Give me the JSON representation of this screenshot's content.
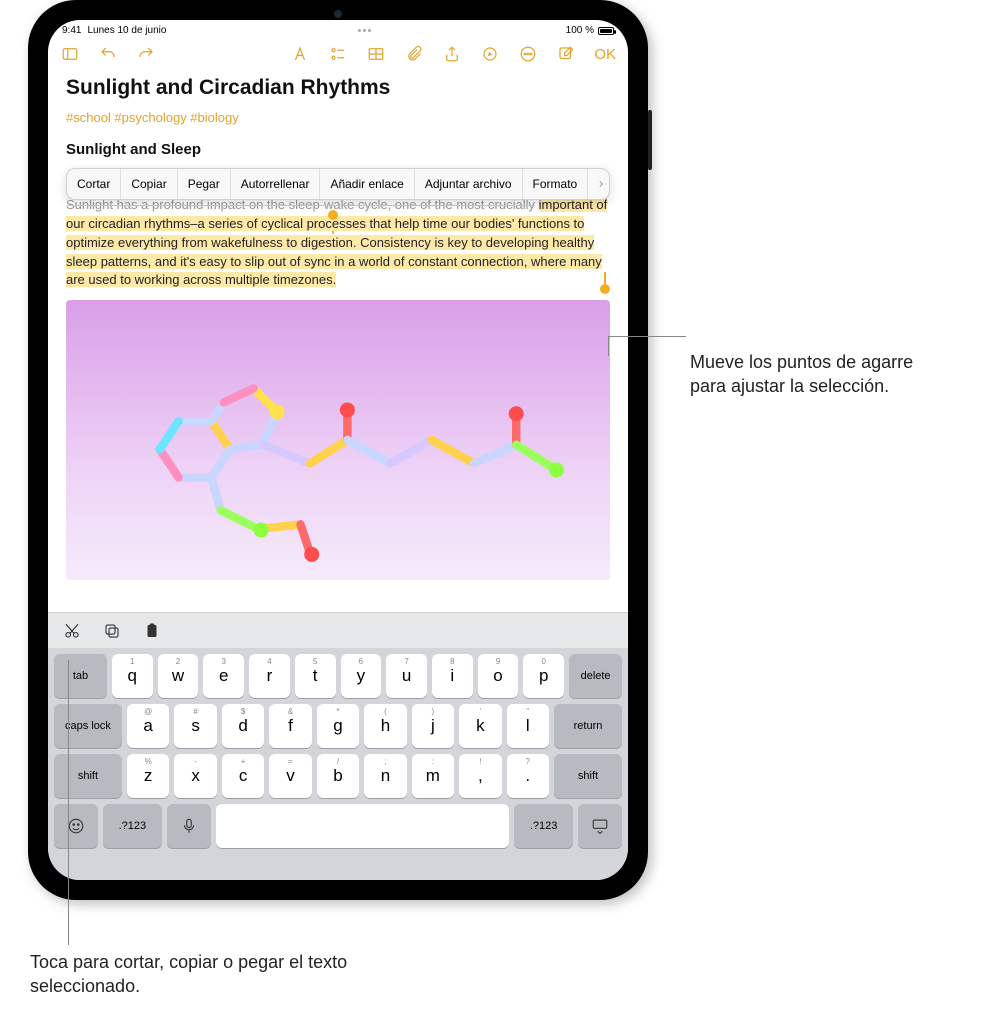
{
  "status": {
    "time": "9:41",
    "date": "Lunes 10 de junio",
    "battery": "100 %"
  },
  "toolbar": {
    "done": "OK"
  },
  "note": {
    "title": "Sunlight and Circadian Rhythms",
    "tags": "#school #psychology #biology",
    "subtitle": "Sunlight and Sleep",
    "para_dimmed": "Sunlight has a profound impact on the sleep-wake cycle, one of the most crucially",
    "para_highlight": "important of our circadian rhythms–a series of cyclical processes that help time our bodies' functions to optimize everything from wakefulness to digestion. Consistency is key to developing healthy sleep patterns, and it's easy to slip out of sync in a world of constant connection, where many are used to working across multiple timezones."
  },
  "context_menu": {
    "items": [
      "Cortar",
      "Copiar",
      "Pegar",
      "Autorrellenar",
      "Añadir enlace",
      "Adjuntar archivo",
      "Formato"
    ]
  },
  "keyboard": {
    "row1_alt": [
      "1",
      "2",
      "3",
      "4",
      "5",
      "6",
      "7",
      "8",
      "9",
      "0"
    ],
    "row1": [
      "q",
      "w",
      "e",
      "r",
      "t",
      "y",
      "u",
      "i",
      "o",
      "p"
    ],
    "row2_alt": [
      "@",
      "#",
      "$",
      "&",
      "*",
      "(",
      ")",
      "'",
      "\""
    ],
    "row2": [
      "a",
      "s",
      "d",
      "f",
      "g",
      "h",
      "j",
      "k",
      "l"
    ],
    "row3_alt": [
      "%",
      "-",
      "+",
      "=",
      "/",
      ";",
      ":",
      "!",
      "?"
    ],
    "row3": [
      "z",
      "x",
      "c",
      "v",
      "b",
      "n",
      "m",
      ",",
      "."
    ],
    "tab": "tab",
    "delete": "delete",
    "caps": "caps lock",
    "return": "return",
    "shift": "shift",
    "numkey": ".?123"
  },
  "callouts": {
    "right": "Mueve los puntos de agarre para ajustar la selección.",
    "bottom": "Toca para cortar, copiar o pegar el texto seleccionado."
  }
}
